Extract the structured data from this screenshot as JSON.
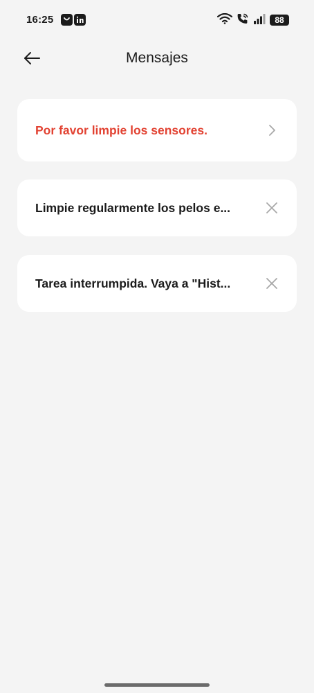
{
  "status_bar": {
    "time": "16:25",
    "battery": "88",
    "icons": [
      "app-notification-icon",
      "linkedin-icon",
      "wifi-icon",
      "wifi-calling-icon",
      "signal-icon",
      "battery-icon"
    ]
  },
  "header": {
    "title": "Mensajes",
    "back_icon": "back-arrow-icon"
  },
  "messages": [
    {
      "text": "Por favor limpie los sensores.",
      "action_icon": "chevron-right-icon",
      "color": "#e24232"
    },
    {
      "text": "Limpie regularmente los pelos e...",
      "action_icon": "close-icon",
      "color": "#1b1b1b"
    },
    {
      "text": "Tarea interrumpida. Vaya a \"Hist...",
      "action_icon": "close-icon",
      "color": "#1b1b1b"
    }
  ],
  "colors": {
    "background": "#f4f4f4",
    "card": "#ffffff",
    "alert_text": "#e24232",
    "text": "#1b1b1b",
    "icon_muted": "#a8a8a8"
  }
}
